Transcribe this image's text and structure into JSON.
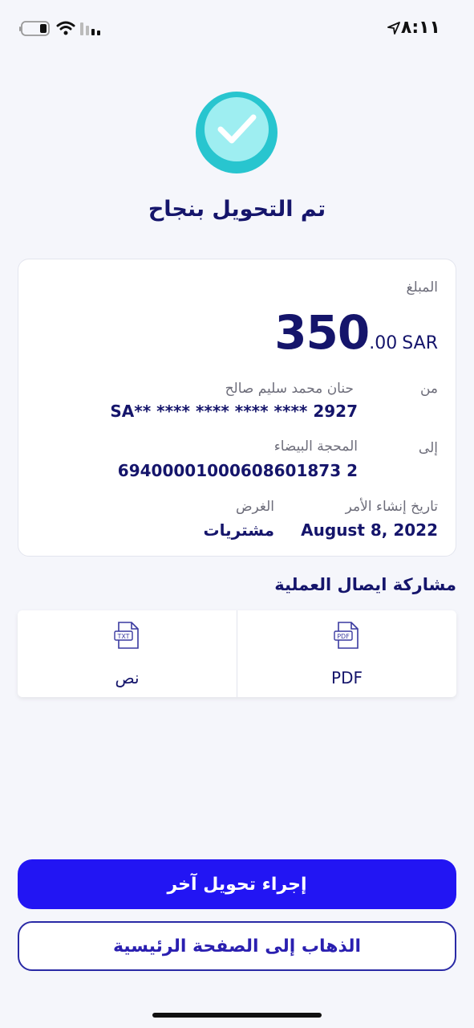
{
  "status_bar": {
    "time": "٨:١١"
  },
  "title": "تم التحويل بنجاح",
  "details": {
    "amount_label": "المبلغ",
    "amount_integer": "350",
    "amount_decimal": ".00",
    "currency": "SAR",
    "from_label": "من",
    "from_name": "حنان محمد سليم صالح",
    "from_account": "SA** **** **** **** **** 2927",
    "to_label": "إلى",
    "to_name": "المحجة البيضاء",
    "to_account": "69400001000608601873 2",
    "date_label": "تاريخ إنشاء الأمر",
    "date_value": "August 8, 2022",
    "purpose_label": "الغرض",
    "purpose_value": "مشتريات"
  },
  "share": {
    "title": "مشاركة ايصال العملية",
    "pdf_label": "PDF",
    "txt_label": "نص"
  },
  "buttons": {
    "new_transfer": "إجراء تحويل آخر",
    "go_home": "الذهاب إلى الصفحة الرئيسية"
  }
}
